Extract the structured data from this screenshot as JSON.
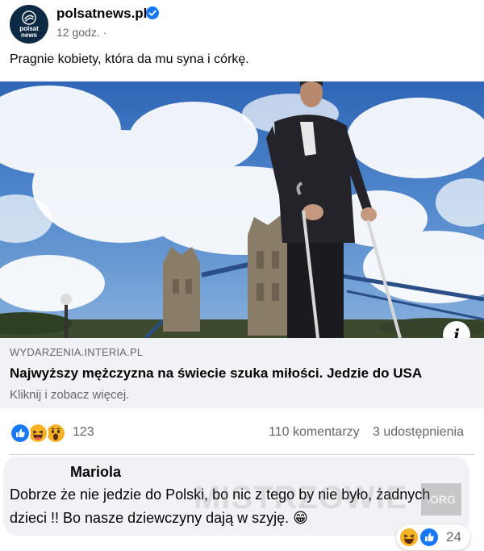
{
  "post": {
    "page_name": "polsatnews.pl",
    "avatar_text_1": "polsat",
    "avatar_text_2": "news",
    "time": "12 godz. ·",
    "text": "Pragnie kobiety, która da mu syna i córkę."
  },
  "link": {
    "domain": "WYDARZENIA.INTERIA.PL",
    "title": "Najwyższy mężczyzna na świecie szuka miłości. Jedzie do USA",
    "subtitle": "Kliknij i zobacz więcej."
  },
  "stats": {
    "reaction_count": "123",
    "comments": "110 komentarzy",
    "shares": "3 udostępnienia",
    "reaction_icons": [
      "like-icon",
      "laugh-icon",
      "wow-icon"
    ]
  },
  "comment": {
    "author": "Mariola",
    "text": "Dobrze że nie jedzie do Polski, bo nic z tego by nie było, żadnych dzieci !! Bo nasze dziewczyny dają w szyję. 😁",
    "reaction_count": "24",
    "reaction_icons": [
      "laugh-icon",
      "like-icon"
    ]
  },
  "watermark": {
    "text": "MISTRZOWIE",
    "org": ".ORG"
  },
  "colors": {
    "facebook_blue": "#1877f2",
    "secondary_text": "#65676b",
    "bubble_bg": "#f0f2f5",
    "avatar_bg": "#0d2a45",
    "reaction_yellow": "#f7b125"
  }
}
